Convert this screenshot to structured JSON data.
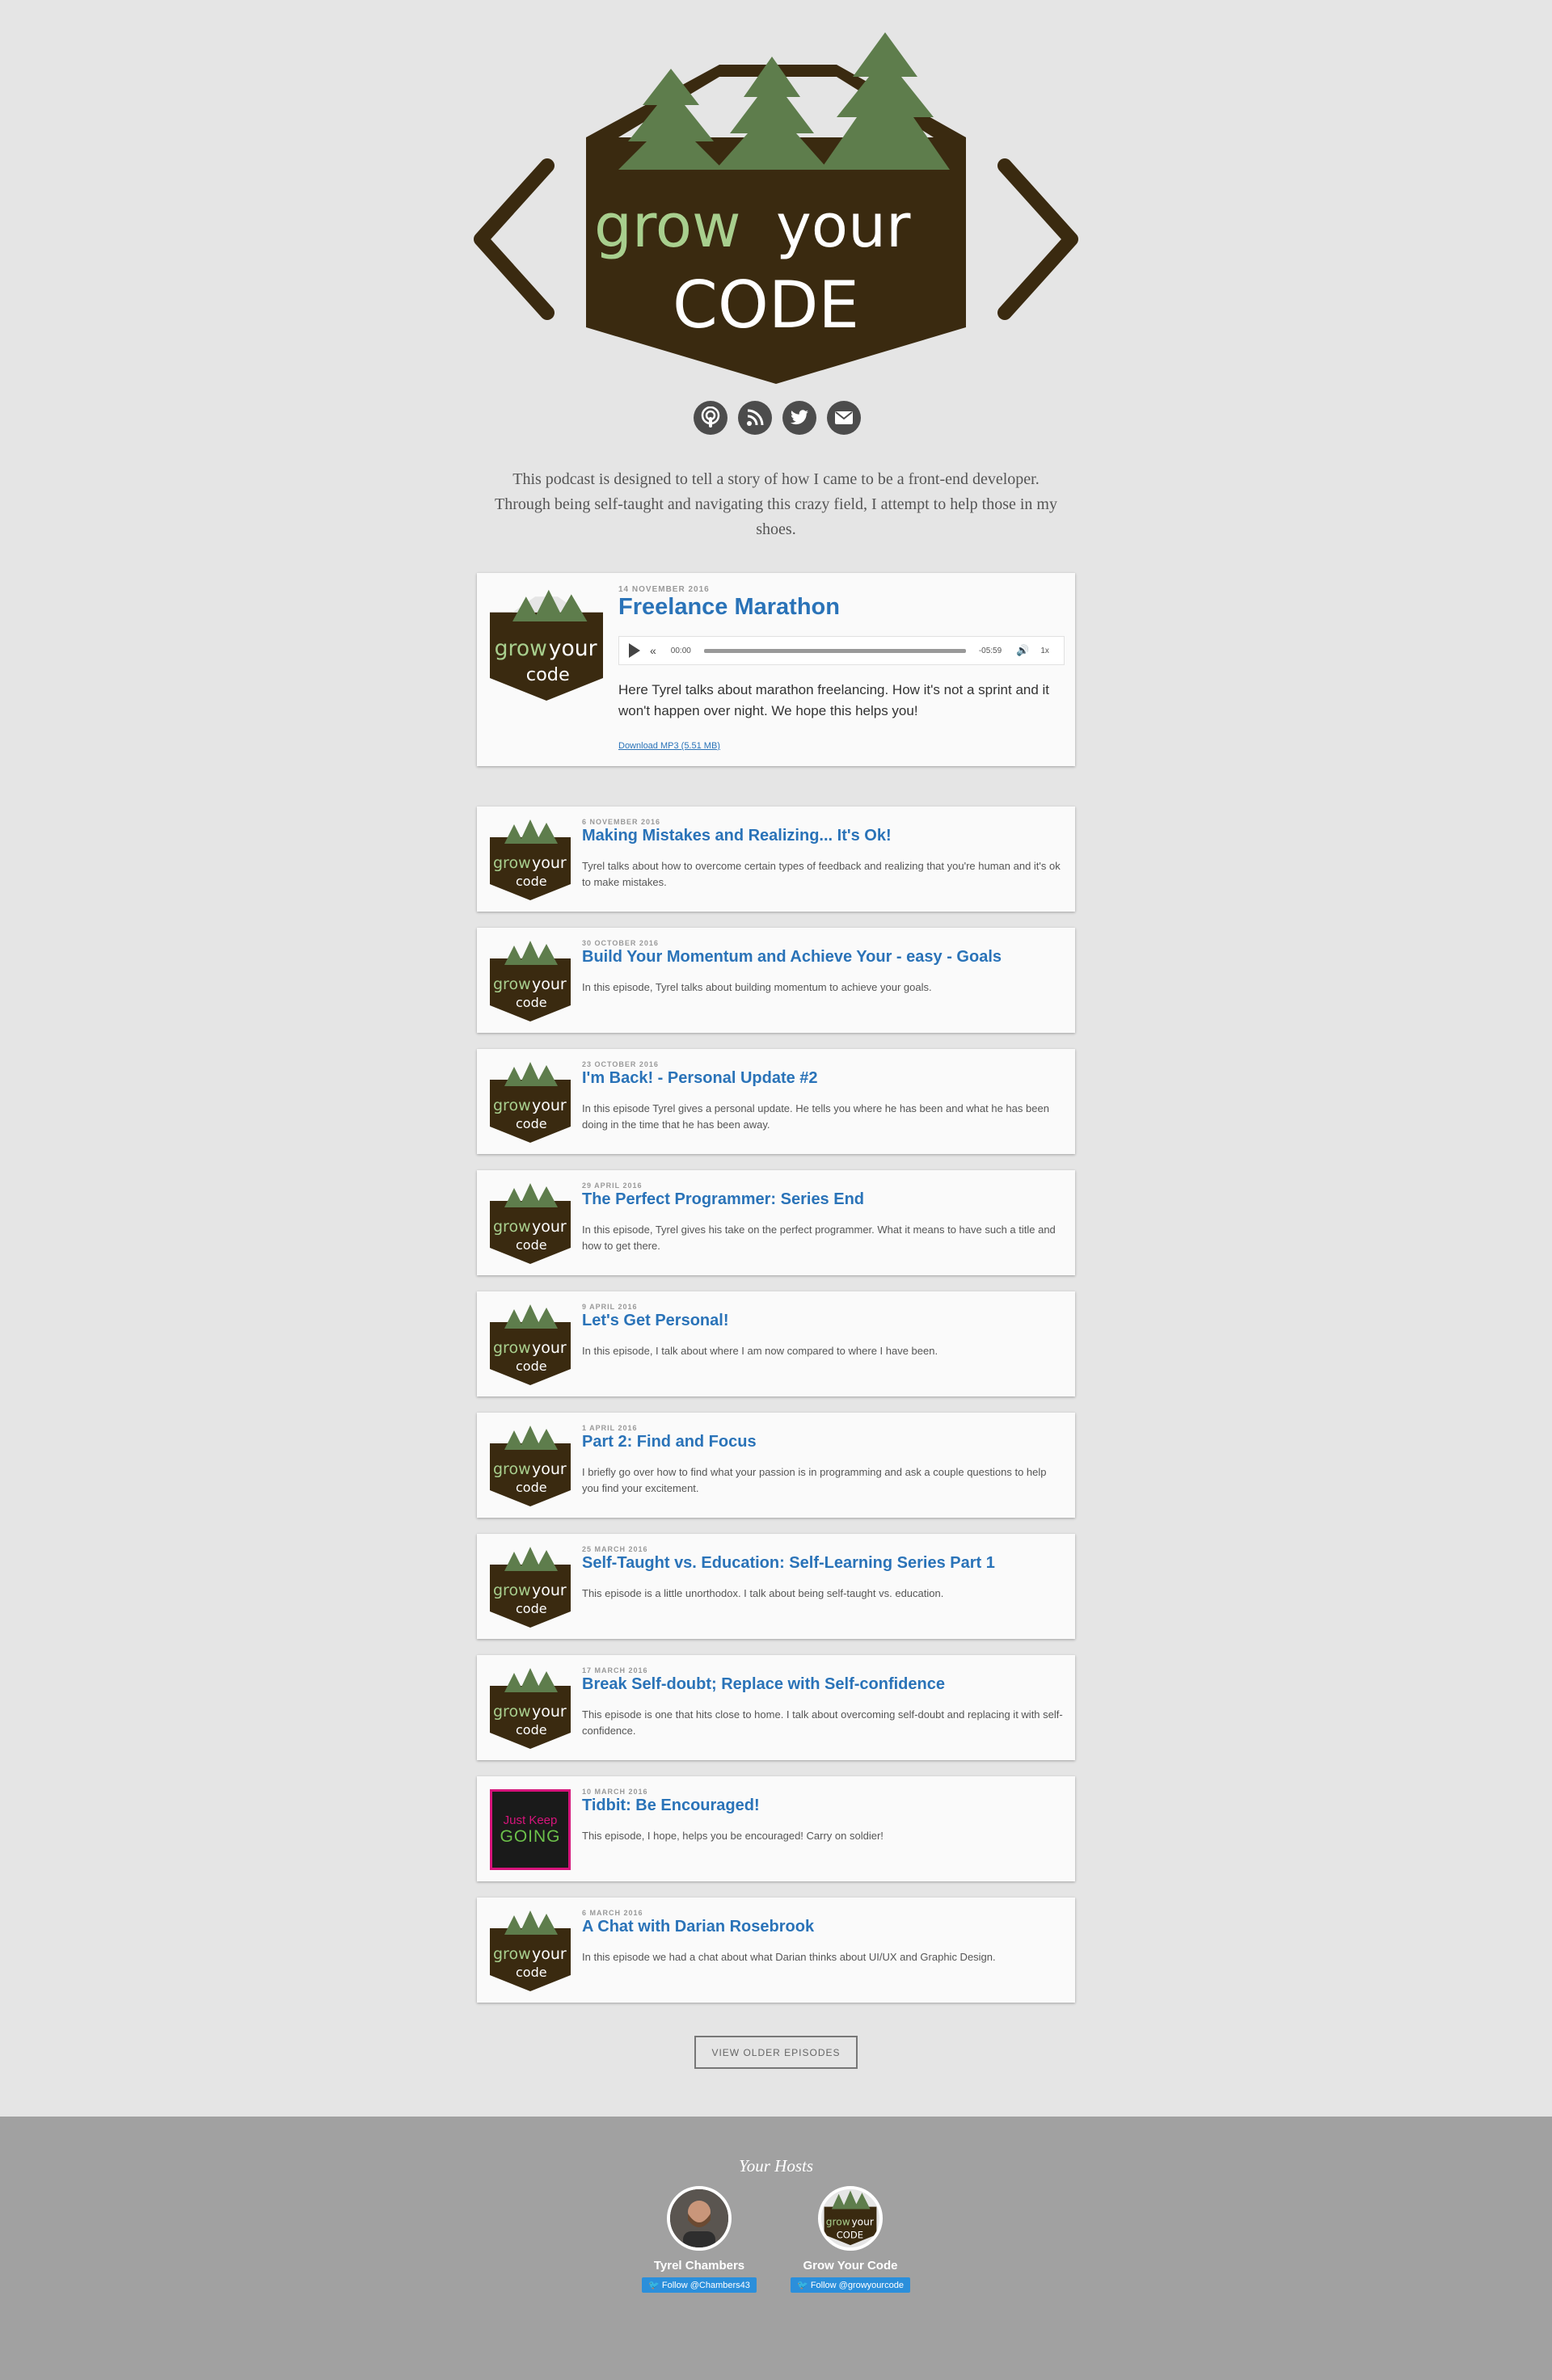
{
  "brand": {
    "word1": "grow",
    "word2": "your",
    "word3": "CODE",
    "thumb_word3": "code"
  },
  "icons": [
    "podcast-icon",
    "rss-icon",
    "twitter-icon",
    "email-icon"
  ],
  "intro": "This podcast is designed to tell a story of how I came to be a front-end developer. Through being self-taught and navigating this crazy field, I attempt to help those in my shoes.",
  "featured": {
    "date": "14 NOVEMBER 2016",
    "title": "Freelance Marathon",
    "player": {
      "current": "00:00",
      "remaining": "-05:59",
      "speed": "1x"
    },
    "description": "Here Tyrel talks about marathon freelancing. How it's not a sprint and it won't happen over night. We hope this helps you!",
    "download": "Download MP3 (5.51 MB)"
  },
  "episodes": [
    {
      "date": "6 NOVEMBER 2016",
      "title": "Making Mistakes and Realizing... It's Ok!",
      "description": "Tyrel talks about how to overcome certain types of feedback and realizing that you're human and it's ok to make mistakes."
    },
    {
      "date": "30 OCTOBER 2016",
      "title": "Build Your Momentum and Achieve Your - easy - Goals",
      "description": "In this episode, Tyrel talks about building momentum to achieve your goals."
    },
    {
      "date": "23 OCTOBER 2016",
      "title": "I'm Back! - Personal Update #2",
      "description": "In this episode Tyrel gives a personal update. He tells you where he has been and what he has been doing in the time that he has been away."
    },
    {
      "date": "29 APRIL 2016",
      "title": "The Perfect Programmer: Series End",
      "description": "In this episode, Tyrel gives his take on the perfect programmer. What it means to have such a title and how to get there."
    },
    {
      "date": "9 APRIL 2016",
      "title": "Let's Get Personal!",
      "description": "In this episode, I talk about where I am now compared to where I have been."
    },
    {
      "date": "1 APRIL 2016",
      "title": "Part 2: Find and Focus",
      "description": "I briefly go over how to find what your passion is in programming and ask a couple questions to help you find your excitement."
    },
    {
      "date": "25 MARCH 2016",
      "title": "Self-Taught vs. Education: Self-Learning Series Part 1",
      "description": "This episode is a little unorthodox. I talk about being self-taught vs. education."
    },
    {
      "date": "17 MARCH 2016",
      "title": "Break Self-doubt; Replace with Self-confidence",
      "description": "This episode is one that hits close to home. I talk about overcoming self-doubt and replacing it with self-confidence."
    },
    {
      "date": "10 MARCH 2016",
      "title": "Tidbit: Be Encouraged!",
      "description": "This episode, I hope, helps you be encouraged! Carry on soldier!"
    },
    {
      "date": "6 MARCH 2016",
      "title": "A Chat with Darian Rosebrook",
      "description": "In this episode we had a chat about what Darian thinks about UI/UX and Graphic Design."
    }
  ],
  "tidbit_art": {
    "line1": "Just Keep",
    "line2": "GOING"
  },
  "older_button": "VIEW OLDER EPISODES",
  "footer": {
    "title": "Your Hosts",
    "hosts": [
      {
        "name": "Tyrel Chambers",
        "follow": "Follow @Chambers43"
      },
      {
        "name": "Grow Your Code",
        "follow": "Follow @growyourcode"
      }
    ]
  },
  "colors": {
    "bark": "#3a2a10",
    "tree": "#5e7d4c",
    "grow": "#a8cf8e",
    "link": "#2a73b8"
  }
}
